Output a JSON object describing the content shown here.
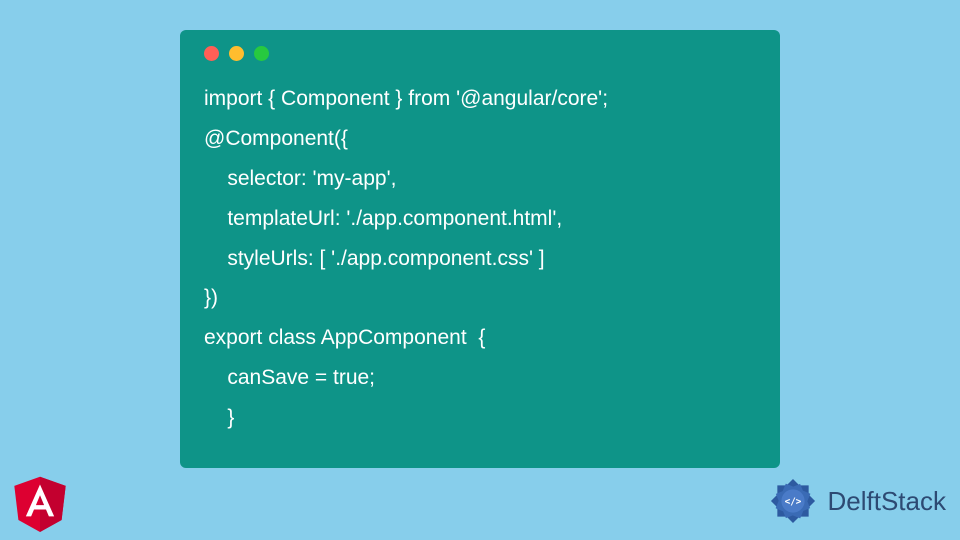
{
  "window": {
    "dots": [
      "red",
      "yellow",
      "green"
    ]
  },
  "code": {
    "lines": [
      "import { Component } from '@angular/core';",
      "@Component({",
      "    selector: 'my-app',",
      "    templateUrl: './app.component.html',",
      "    styleUrls: [ './app.component.css' ]",
      "})",
      "export class AppComponent  {",
      "    canSave = true;",
      "    }"
    ]
  },
  "brand": {
    "angular_name": "Angular",
    "delft_name": "DelftStack"
  }
}
